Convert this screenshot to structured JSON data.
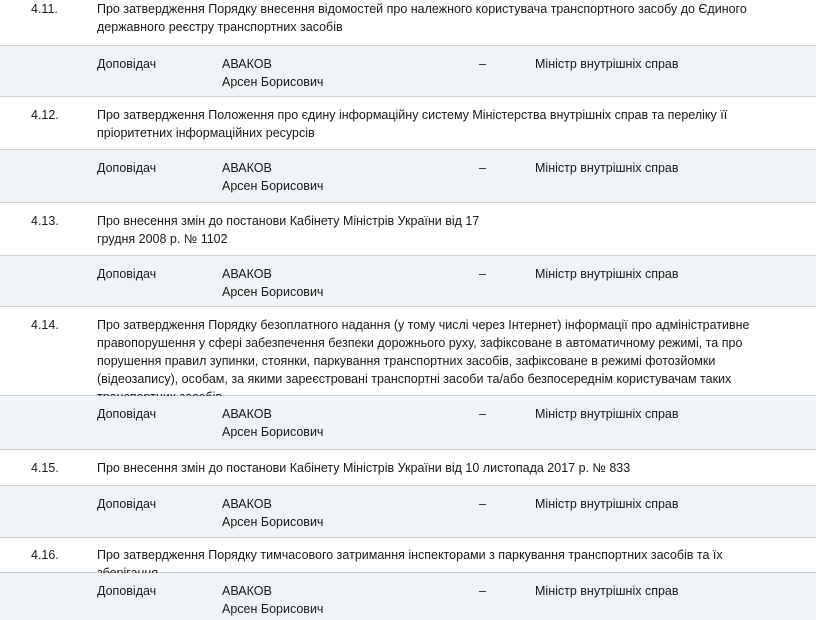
{
  "items": [
    {
      "number": "4.11.",
      "title": "Про затвердження Порядку внесення відомостей про належного користувача транспортного засобу до Єдиного державного реєстру транспортних засобів"
    },
    {
      "number": "4.12.",
      "title": "Про  затвердження Положення про єдину інформаційну систему Міністерства внутрішніх справ та переліку її пріоритетних інформаційних ресурсів"
    },
    {
      "number": "4.13.",
      "title": "Про внесення змін до постанови Кабінету Міністрів України від 17 грудня 2008 р. № 1102"
    },
    {
      "number": "4.14.",
      "title": "Про затвердження Порядку безоплатного надання (у тому числі через Інтернет) інформації про адміністративне правопорушення у сфері забезпечення безпеки дорожнього руху, зафіксоване в автоматичному режимі, та про порушення правил зупинки, стоянки, паркування транспортних засобів, зафіксоване в режимі фотозйомки (відеозапису), особам, за якими зареєстровані транспортні засоби та/або безпосереднім користувачам таких транспортних засобів"
    },
    {
      "number": "4.15.",
      "title": "Про внесення змін до постанови Кабінету Міністрів України від 10 листопада 2017 р. № 833"
    },
    {
      "number": "4.16.",
      "title": "Про затвердження Порядку тимчасового затримання інспекторами з паркування транспортних засобів та їх зберігання"
    }
  ],
  "speaker": {
    "label": "Доповідач",
    "surname": "АВАКОВ",
    "given_names": "Арсен Борисович",
    "dash": "–",
    "role": "Міністр внутрішніх справ"
  }
}
